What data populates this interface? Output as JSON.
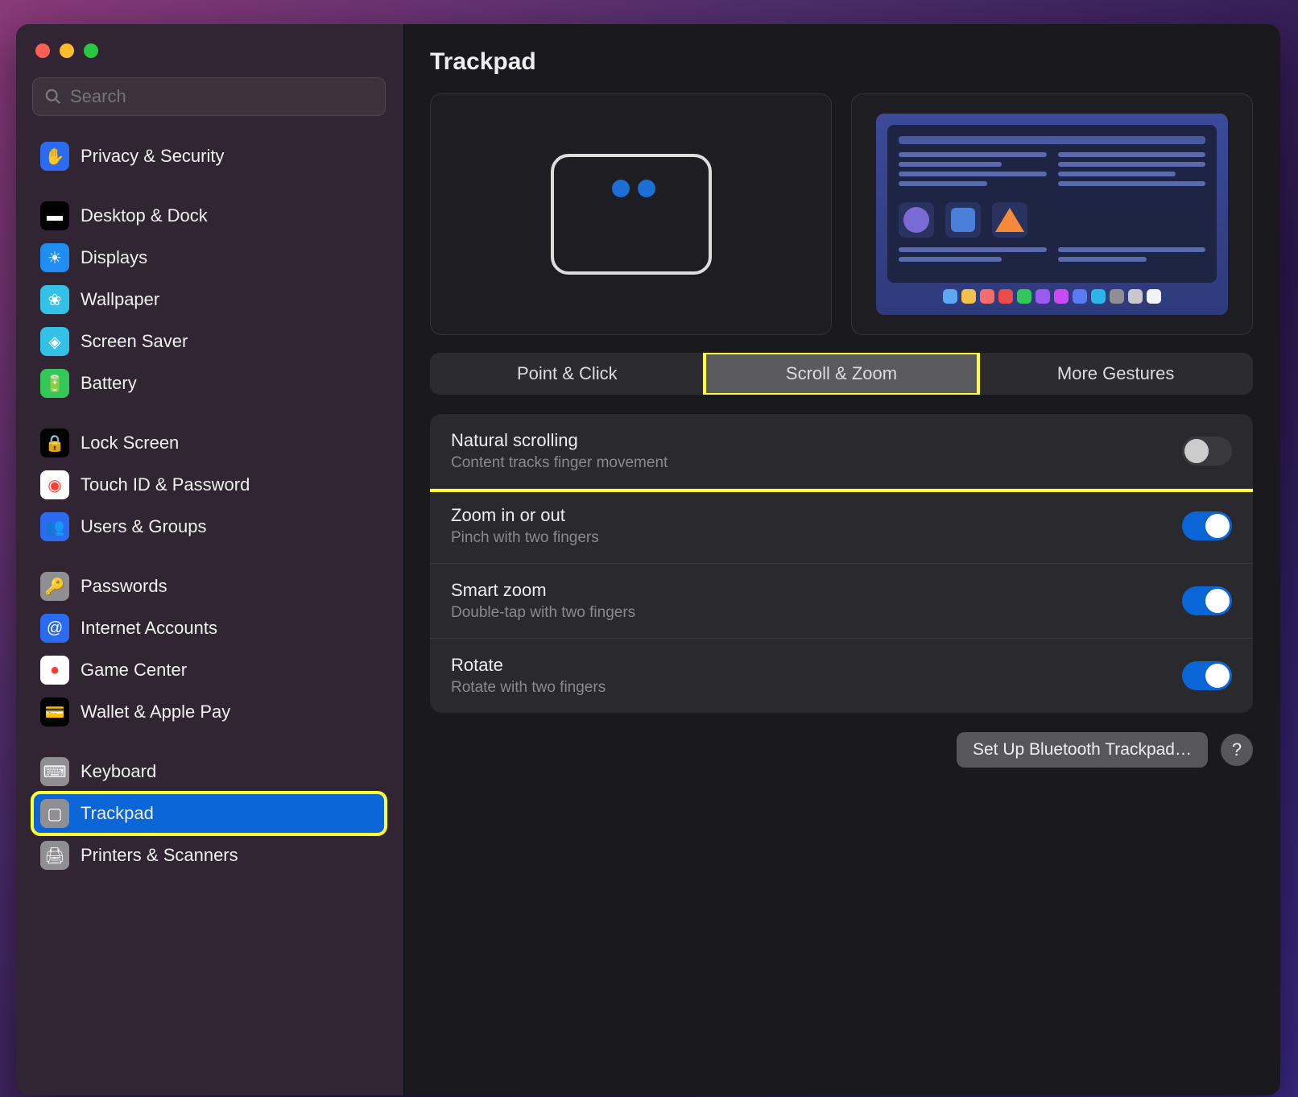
{
  "search": {
    "placeholder": "Search"
  },
  "sidebar": {
    "groups": [
      {
        "items": [
          {
            "label": "Privacy & Security",
            "icon": "hand-icon",
            "bg": "#2b6bf2",
            "fg": "#ffffff"
          }
        ]
      },
      {
        "items": [
          {
            "label": "Desktop & Dock",
            "icon": "dock-icon",
            "bg": "#000000",
            "fg": "#ffffff"
          },
          {
            "label": "Displays",
            "icon": "displays-icon",
            "bg": "#1f8ef2",
            "fg": "#ffffff"
          },
          {
            "label": "Wallpaper",
            "icon": "wallpaper-icon",
            "bg": "#33c1e8",
            "fg": "#ffffff"
          },
          {
            "label": "Screen Saver",
            "icon": "screen-saver-icon",
            "bg": "#33c1e8",
            "fg": "#ffffff"
          },
          {
            "label": "Battery",
            "icon": "battery-icon",
            "bg": "#34c759",
            "fg": "#ffffff"
          }
        ]
      },
      {
        "items": [
          {
            "label": "Lock Screen",
            "icon": "lock-icon",
            "bg": "#000000",
            "fg": "#ffffff"
          },
          {
            "label": "Touch ID & Password",
            "icon": "touchid-icon",
            "bg": "#ffffff",
            "fg": "#ff3b30"
          },
          {
            "label": "Users & Groups",
            "icon": "users-icon",
            "bg": "#2b6bf2",
            "fg": "#ffffff"
          }
        ]
      },
      {
        "items": [
          {
            "label": "Passwords",
            "icon": "key-icon",
            "bg": "#8e8e93",
            "fg": "#ffffff"
          },
          {
            "label": "Internet Accounts",
            "icon": "at-icon",
            "bg": "#2b6bf2",
            "fg": "#ffffff"
          },
          {
            "label": "Game Center",
            "icon": "gamecenter-icon",
            "bg": "#ffffff",
            "fg": "#ff3b30"
          },
          {
            "label": "Wallet & Apple Pay",
            "icon": "wallet-icon",
            "bg": "#000000",
            "fg": "#ffffff"
          }
        ]
      },
      {
        "items": [
          {
            "label": "Keyboard",
            "icon": "keyboard-icon",
            "bg": "#8e8e93",
            "fg": "#ffffff"
          },
          {
            "label": "Trackpad",
            "icon": "trackpad-icon",
            "bg": "#8e8e93",
            "fg": "#ffffff",
            "selected": true
          },
          {
            "label": "Printers & Scanners",
            "icon": "printer-icon",
            "bg": "#8e8e93",
            "fg": "#ffffff"
          }
        ]
      }
    ]
  },
  "pane": {
    "title": "Trackpad",
    "tabs": [
      "Point & Click",
      "Scroll & Zoom",
      "More Gestures"
    ],
    "active_tab": 1,
    "settings": [
      {
        "title": "Natural scrolling",
        "sub": "Content tracks finger movement",
        "on": false,
        "highlighted": true
      },
      {
        "title": "Zoom in or out",
        "sub": "Pinch with two fingers",
        "on": true
      },
      {
        "title": "Smart zoom",
        "sub": "Double-tap with two fingers",
        "on": true
      },
      {
        "title": "Rotate",
        "sub": "Rotate with two fingers",
        "on": true
      }
    ],
    "footer_button": "Set Up Bluetooth Trackpad…",
    "help": "?"
  },
  "dock_colors": [
    "#5aa9f2",
    "#f2c14a",
    "#f26d6d",
    "#ef4a4a",
    "#34c759",
    "#9a5af2",
    "#c94af2",
    "#5a7af2",
    "#2bb5e8",
    "#8e8e93",
    "#c7c7cc",
    "#f2f2f7"
  ]
}
